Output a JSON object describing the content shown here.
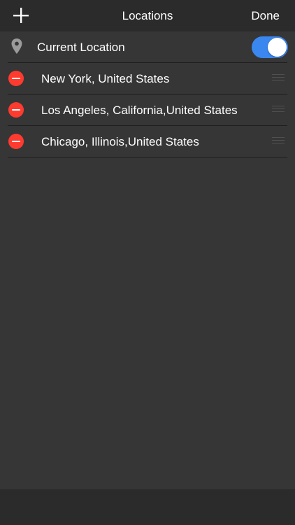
{
  "navbar": {
    "title": "Locations",
    "done_label": "Done",
    "add_icon": "plus-icon"
  },
  "current_location": {
    "label": "Current Location",
    "icon": "location-pin-icon",
    "enabled": true,
    "toggle_color": "#3b87f0"
  },
  "locations": [
    {
      "label": "New York, United States"
    },
    {
      "label": "Los Angeles, California,United States"
    },
    {
      "label": "Chicago, Illinois,United States"
    }
  ],
  "colors": {
    "background": "#363636",
    "bar": "#2b2b2b",
    "delete": "#ff3b30",
    "text": "#ffffff"
  }
}
